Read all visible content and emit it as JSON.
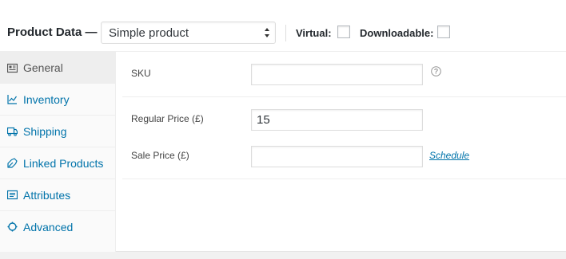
{
  "header": {
    "title": "Product Data —",
    "product_type": "Simple product",
    "virtual_label": "Virtual:",
    "downloadable_label": "Downloadable:",
    "virtual_checked": false,
    "downloadable_checked": false
  },
  "tabs": [
    {
      "label": "General",
      "icon": "general-icon",
      "active": true
    },
    {
      "label": "Inventory",
      "icon": "inventory-icon",
      "active": false
    },
    {
      "label": "Shipping",
      "icon": "shipping-icon",
      "active": false
    },
    {
      "label": "Linked Products",
      "icon": "linked-products-icon",
      "active": false
    },
    {
      "label": "Attributes",
      "icon": "attributes-icon",
      "active": false
    },
    {
      "label": "Advanced",
      "icon": "advanced-icon",
      "active": false
    }
  ],
  "fields": {
    "sku": {
      "label": "SKU",
      "value": ""
    },
    "regular_price": {
      "label": "Regular Price (£)",
      "value": "15"
    },
    "sale_price": {
      "label": "Sale Price (£)",
      "value": ""
    },
    "schedule_link": "Schedule"
  },
  "colors": {
    "link": "#0073aa",
    "active_tab_bg": "#eeeeee",
    "tabs_bg": "#fafafa"
  }
}
